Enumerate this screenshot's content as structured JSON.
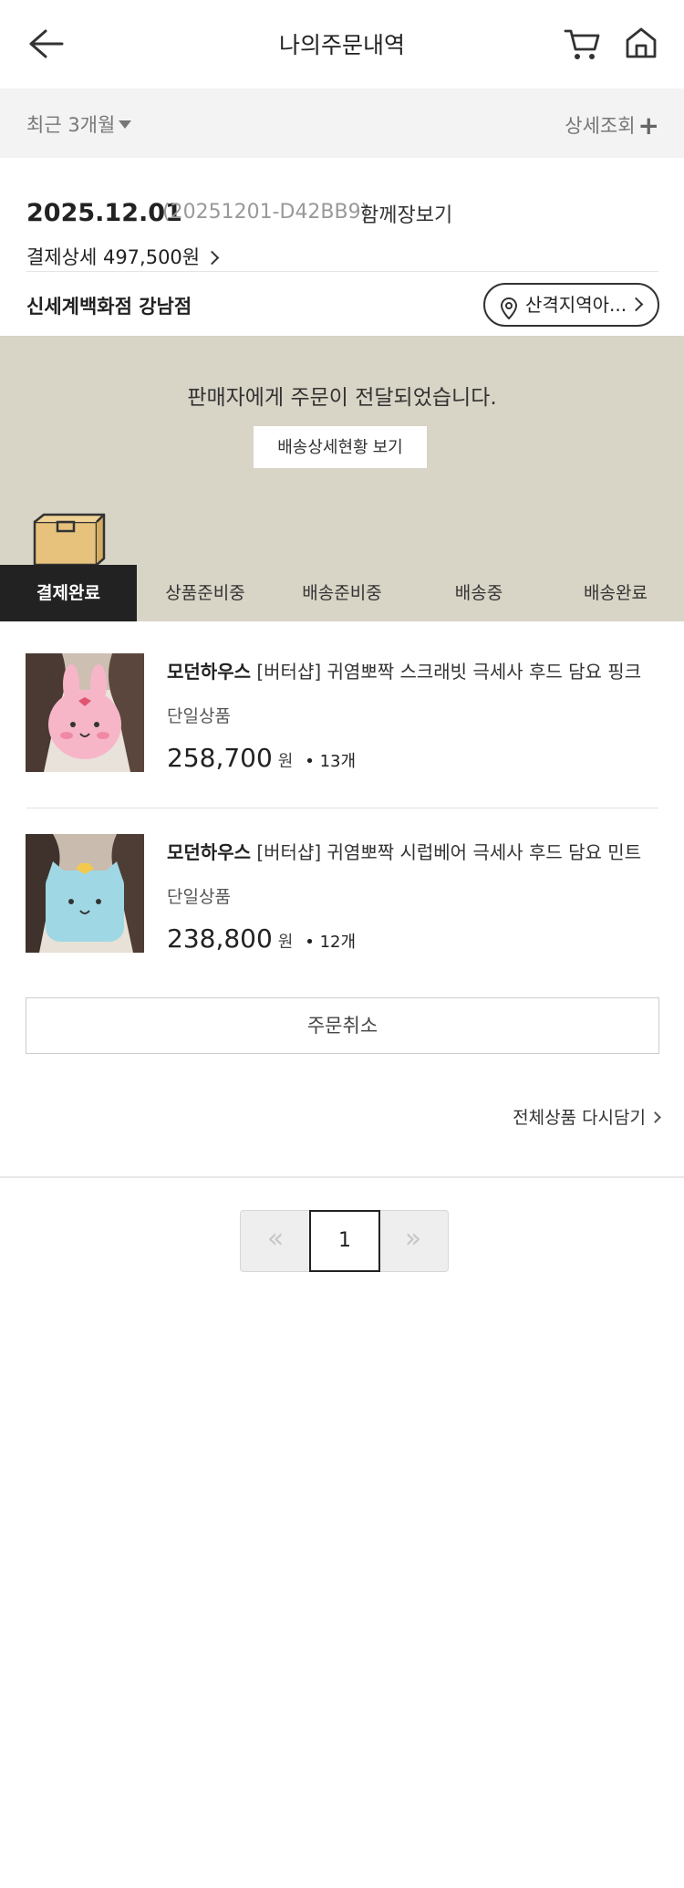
{
  "header": {
    "title": "나의주문내역",
    "back_icon": "back-arrow-icon",
    "cart_icon": "cart-icon",
    "home_icon": "home-icon"
  },
  "filter": {
    "period": "최근 3개월",
    "detail": "상세조회"
  },
  "order": {
    "date": "2025.12.01",
    "number": "(20251201-D42BB9)",
    "together_label": "함께장보기",
    "payment": "결제상세 497,500원",
    "store": "신세계백화점 강남점",
    "region_button": "산격지역아..."
  },
  "status": {
    "message": "판매자에게 주문이 전달되었습니다.",
    "track_button": "배송상세현황 보기",
    "steps": [
      "결제완료",
      "상품준비중",
      "배송준비중",
      "배송중",
      "배송완료"
    ],
    "active_step": 0
  },
  "products": [
    {
      "brand": "모던하우스",
      "name": "[버터샵] 귀염뽀짝 스크래빗 극세사 후드 담요 핑크",
      "option": "단일상품",
      "price": "258,700",
      "unit": "원",
      "qty": "• 13개",
      "color": "#f6b6c8"
    },
    {
      "brand": "모던하우스",
      "name": "[버터샵] 귀염뽀짝 시럽베어 극세사 후드 담요 민트",
      "option": "단일상품",
      "price": "238,800",
      "unit": "원",
      "qty": "• 12개",
      "color": "#9fd8e4"
    }
  ],
  "actions": {
    "cancel": "주문취소",
    "recart": "전체상품 다시담기"
  },
  "pagination": {
    "current": "1",
    "prev": "«",
    "next": "»"
  }
}
